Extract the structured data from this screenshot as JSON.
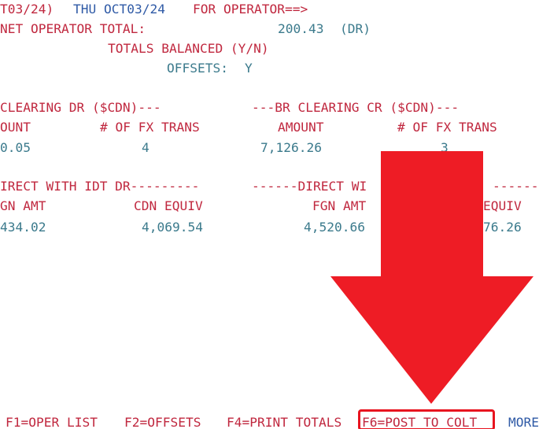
{
  "header": {
    "date_fragment": "T03/24)",
    "day_date": "THU OCT03/24",
    "for_operator": "FOR OPERATOR==>"
  },
  "net_total": {
    "label": "NET OPERATOR TOTAL:",
    "value": "200.43",
    "dr_marker": "(DR)"
  },
  "totals_balanced": {
    "label": "TOTALS BALANCED (Y/N)"
  },
  "offsets": {
    "label": "OFFSETS:",
    "value": "Y"
  },
  "clearing": {
    "dr_title": "CLEARING DR ($CDN)---",
    "cr_title": "---BR CLEARING CR ($CDN)---",
    "amount_header_left": "OUNT",
    "fx_header_left": "# OF FX TRANS",
    "amount_header_right": "AMOUNT",
    "fx_header_right": "# OF FX TRANS",
    "dr_amount": "0.05",
    "dr_fx_count": "4",
    "cr_amount": "7,126.26",
    "cr_fx_count": "3"
  },
  "idt": {
    "dr_title": "IRECT WITH IDT DR---------",
    "cr_title": "------DIRECT WI",
    "cr_title_tail": "------",
    "fgn_header_left": "GN AMT",
    "cdn_header_left": "CDN EQUIV",
    "fgn_header_right": "FGN AMT",
    "cdn_header_right": "EQUIV",
    "dr_fgn_amount": "434.02",
    "dr_cdn_equiv": "4,069.54",
    "cr_fgn_amount": "4,520.66",
    "cr_cdn_equiv": "76.26"
  },
  "function_keys": [
    {
      "label": "F1=OPER LIST"
    },
    {
      "label": "F2=OFFSETS"
    },
    {
      "label": "F4=PRINT TOTALS"
    },
    {
      "label": "F6=POST TO COLT"
    },
    {
      "label": "MORE"
    }
  ],
  "colors": {
    "label_red": "#c0283f",
    "header_blue": "#2f5aa6",
    "value_teal": "#3b7a8c",
    "annotation_red": "#e8141f"
  }
}
